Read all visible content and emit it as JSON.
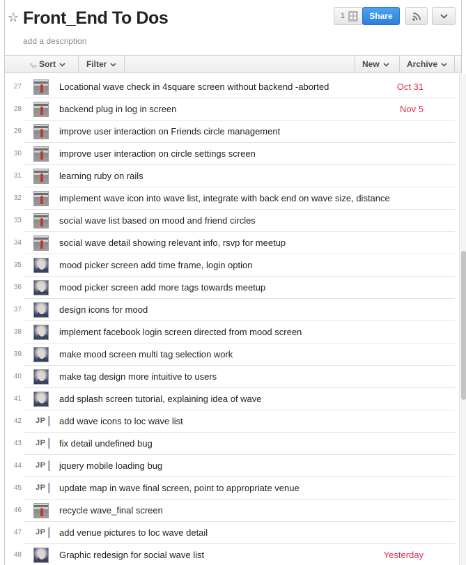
{
  "header": {
    "title": "Front_End To Dos",
    "description_placeholder": "add a description",
    "member_count": "1",
    "share_label": "Share"
  },
  "toolbar": {
    "sort_icon": "¹₂₃",
    "sort_label": "Sort",
    "filter_label": "Filter",
    "new_label": "New",
    "archive_label": "Archive"
  },
  "colors": {
    "accent": "#2c7fd8",
    "due_date": "#d9324d"
  },
  "tasks": [
    {
      "num": "27",
      "owner": "avatar1",
      "text": "Locational wave check in 4square screen without backend -aborted",
      "due": "Oct 31"
    },
    {
      "num": "28",
      "owner": "avatar1",
      "text": "backend plug in log in screen",
      "due": "Nov 5"
    },
    {
      "num": "29",
      "owner": "avatar1",
      "text": "improve user interaction on Friends circle management",
      "due": ""
    },
    {
      "num": "30",
      "owner": "avatar1",
      "text": "improve user interaction on circle settings screen",
      "due": ""
    },
    {
      "num": "31",
      "owner": "avatar1",
      "text": "learning ruby on rails",
      "due": ""
    },
    {
      "num": "32",
      "owner": "avatar1",
      "text": "implement wave icon into wave list, integrate with back end on wave size, distance",
      "due": ""
    },
    {
      "num": "33",
      "owner": "avatar1",
      "text": "social wave list based on mood and friend circles",
      "due": ""
    },
    {
      "num": "34",
      "owner": "avatar1",
      "text": "social wave detail showing relevant info, rsvp for meetup",
      "due": ""
    },
    {
      "num": "35",
      "owner": "avatar2",
      "text": "mood picker screen add time frame, login option",
      "due": ""
    },
    {
      "num": "36",
      "owner": "avatar2",
      "text": "mood picker screen add more tags towards meetup",
      "due": ""
    },
    {
      "num": "37",
      "owner": "avatar2",
      "text": "design icons for mood",
      "due": ""
    },
    {
      "num": "38",
      "owner": "avatar2",
      "text": "implement facebook login screen directed from mood screen",
      "due": ""
    },
    {
      "num": "39",
      "owner": "avatar2",
      "text": "make mood screen multi tag selection work",
      "due": ""
    },
    {
      "num": "40",
      "owner": "avatar2",
      "text": "make tag design more intuitive to users",
      "due": ""
    },
    {
      "num": "41",
      "owner": "avatar2",
      "text": "add splash screen tutorial, explaining idea of wave",
      "due": ""
    },
    {
      "num": "42",
      "owner": "JP",
      "text": "add wave icons to loc wave list",
      "due": ""
    },
    {
      "num": "43",
      "owner": "JP",
      "text": "fix detail undefined bug",
      "due": ""
    },
    {
      "num": "44",
      "owner": "JP",
      "text": "jquery mobile loading bug",
      "due": ""
    },
    {
      "num": "45",
      "owner": "JP",
      "text": "update map in wave final screen, point to appropriate venue",
      "due": ""
    },
    {
      "num": "46",
      "owner": "avatar1",
      "text": "recycle wave_final screen",
      "due": ""
    },
    {
      "num": "47",
      "owner": "JP",
      "text": "add venue pictures to loc wave detail",
      "due": ""
    },
    {
      "num": "48",
      "owner": "avatar2",
      "text": "Graphic redesign for social wave list",
      "due": "Yesterday"
    }
  ]
}
